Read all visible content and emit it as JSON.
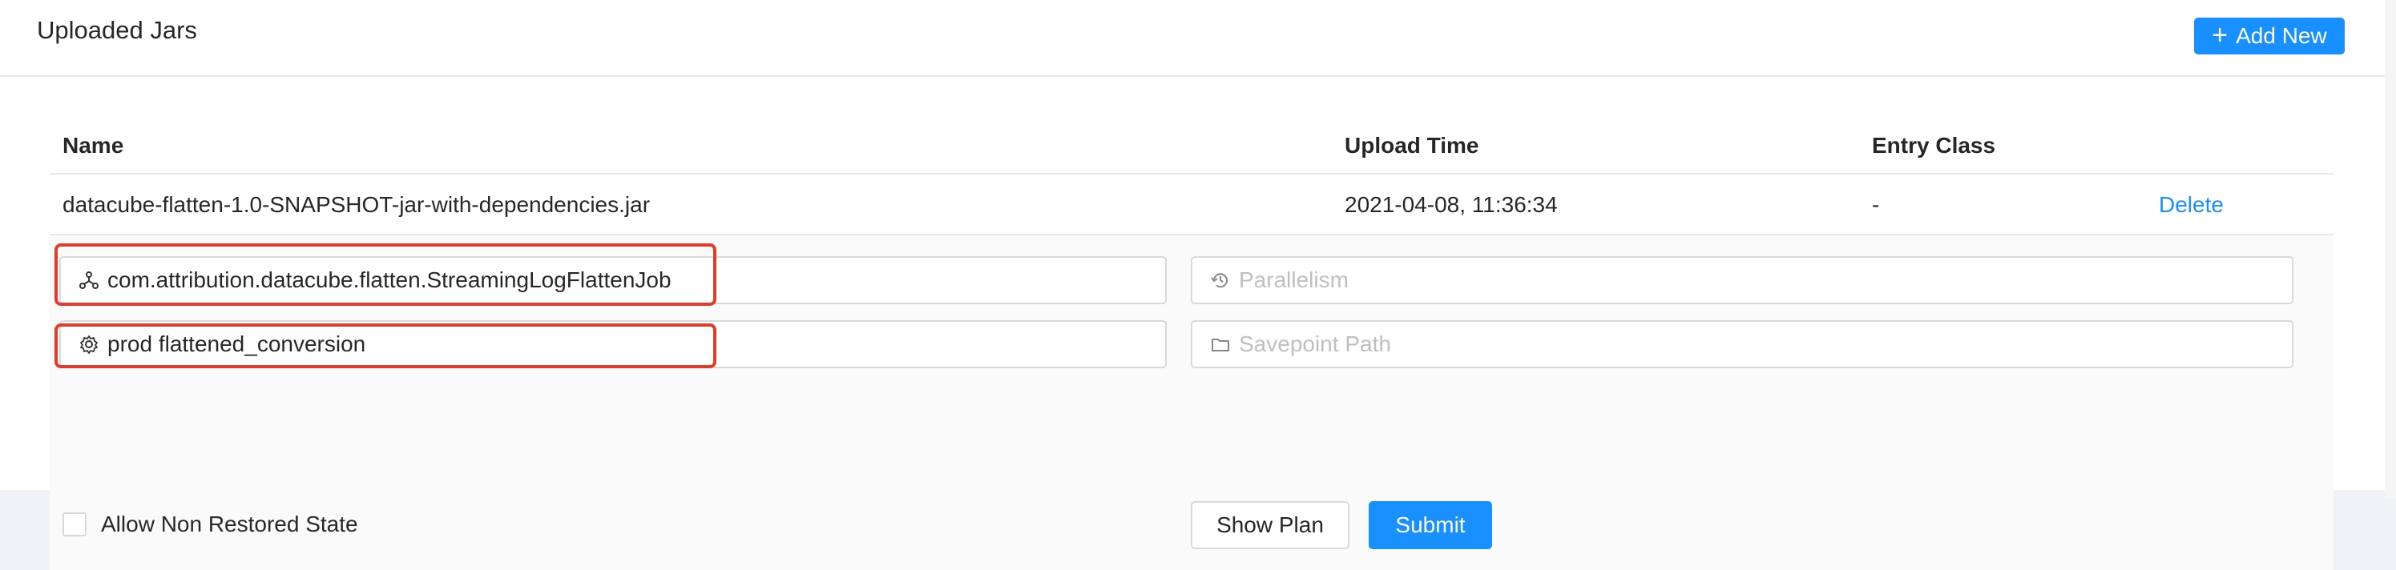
{
  "header": {
    "title": "Uploaded Jars",
    "add_button_label": "Add New",
    "add_button_icon": "plus-icon"
  },
  "table": {
    "columns": [
      "Name",
      "Upload Time",
      "Entry Class"
    ],
    "rows": [
      {
        "name": "datacube-flatten-1.0-SNAPSHOT-jar-with-dependencies.jar",
        "upload_time": "2021-04-08, 11:36:34",
        "entry_class": "-",
        "action": "Delete"
      }
    ]
  },
  "submit_form": {
    "entry_class_value": "com.attribution.datacube.flatten.StreamingLogFlattenJob",
    "entry_class_icon": "cluster-icon",
    "program_args_value": "prod flattened_conversion",
    "program_args_icon": "gear-icon",
    "parallelism_placeholder": "Parallelism",
    "parallelism_icon": "refresh-icon",
    "savepoint_placeholder": "Savepoint Path",
    "savepoint_icon": "folder-icon",
    "allow_non_restored_label": "Allow Non Restored State",
    "allow_non_restored_checked": false,
    "show_plan_label": "Show Plan",
    "submit_label": "Submit"
  },
  "colors": {
    "primary": "#1890ff",
    "highlight_border": "#e03c2c",
    "expanded_background": "#fafafa",
    "page_background": "#f0f2f5"
  }
}
